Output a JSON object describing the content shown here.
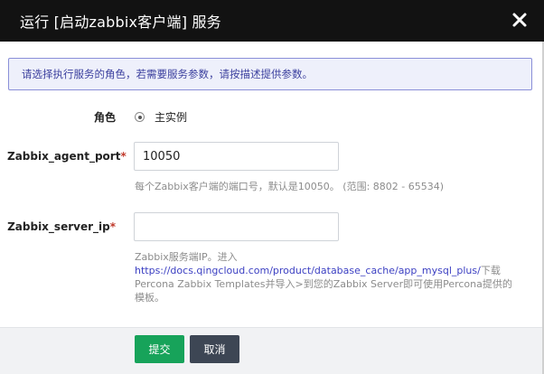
{
  "header": {
    "title": "运行 [启动zabbix客户端] 服务",
    "close_icon": "close-icon"
  },
  "notice": {
    "text": "请选择执行服务的角色，若需要服务参数，请按描述提供参数。"
  },
  "form": {
    "role": {
      "label": "角色",
      "option": "主实例",
      "selected": true
    },
    "agent_port": {
      "label": "Zabbix_agent_port",
      "required_mark": "*",
      "value": "10050",
      "help": "每个Zabbix客户端的端口号，默认是10050。 (范围: 8802 - 65534)"
    },
    "server_ip": {
      "label": "Zabbix_server_ip",
      "required_mark": "*",
      "value": "",
      "help_line1": "Zabbix服务端IP。进入",
      "help_link": "https://docs.qingcloud.com/product/database_cache/app_mysql_plus/",
      "help_after_link": "下载",
      "help_line3": "Percona Zabbix Templates并导入>到您的Zabbix Server即可使用Percona提供的",
      "help_line4": "模板。"
    }
  },
  "footer": {
    "submit_label": "提交",
    "cancel_label": "取消"
  },
  "colors": {
    "header_bg": "#121212",
    "submit": "#17a35a",
    "cancel": "#3d4654",
    "notice_border": "#8a8fd8",
    "link": "#3b3fc2"
  }
}
